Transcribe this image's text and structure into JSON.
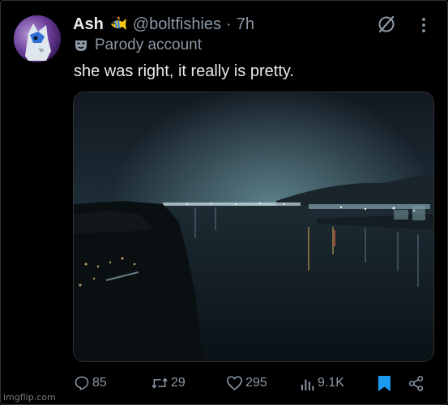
{
  "tweet": {
    "author_name": "Ash",
    "handle": "@boltfishies",
    "separator": "·",
    "time": "7h",
    "label": "Parody account",
    "text": "she was right, it really is pretty.",
    "icons": {
      "name_badge": "fish-icon",
      "label": "mask-icon",
      "grok": "grok-icon",
      "more": "more-icon"
    }
  },
  "actions": {
    "replies": "85",
    "reposts": "29",
    "likes": "295",
    "views": "9.1K",
    "bookmarked": true,
    "bookmark_color": "#1d9bf0"
  },
  "watermark": "imgflip.com",
  "colors": {
    "background": "#000000",
    "text_primary": "#e7e9ea",
    "text_secondary": "#8b98a5",
    "accent": "#1d9bf0"
  }
}
